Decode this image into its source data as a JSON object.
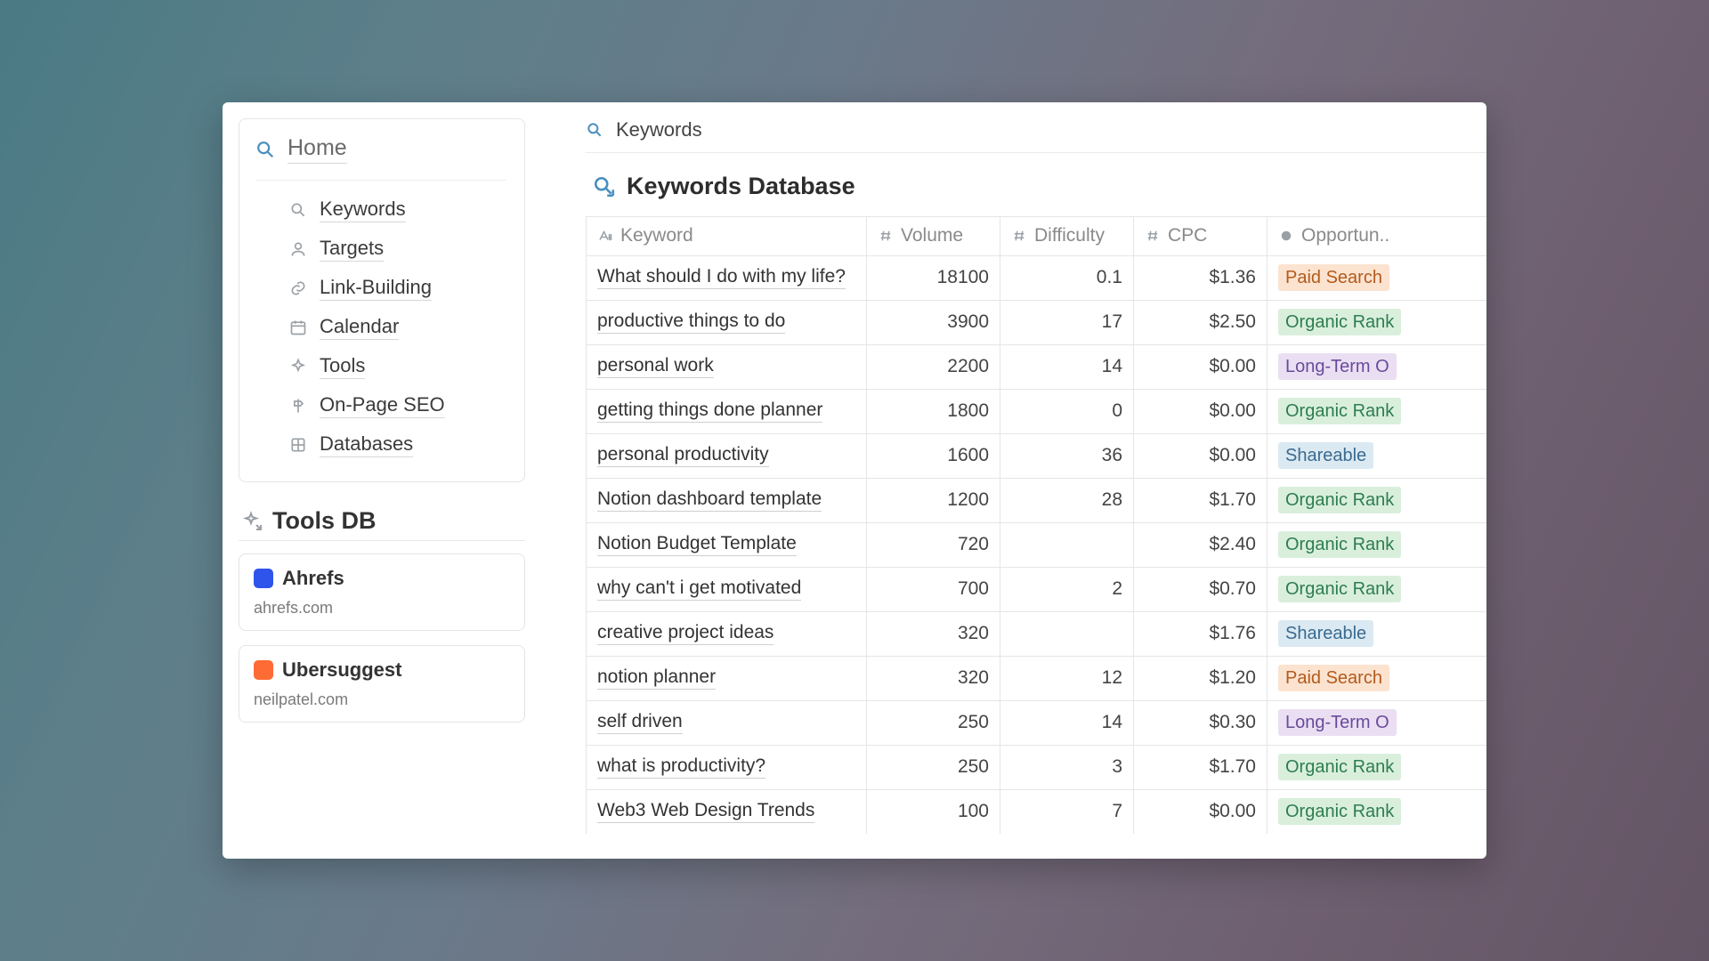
{
  "sidebar": {
    "home_label": "Home",
    "items": [
      {
        "label": "Keywords"
      },
      {
        "label": "Targets"
      },
      {
        "label": "Link-Building"
      },
      {
        "label": "Calendar"
      },
      {
        "label": "Tools"
      },
      {
        "label": "On-Page SEO"
      },
      {
        "label": "Databases"
      }
    ]
  },
  "tools_db": {
    "title": "Tools DB",
    "cards": [
      {
        "name": "Ahrefs",
        "domain": "ahrefs.com",
        "icon_color": "#2f54eb"
      },
      {
        "name": "Ubersuggest",
        "domain": "neilpatel.com",
        "icon_color": "#ff6b35"
      }
    ]
  },
  "main": {
    "breadcrumb_label": "Keywords",
    "db_title": "Keywords Database",
    "columns": {
      "keyword": "Keyword",
      "volume": "Volume",
      "difficulty": "Difficulty",
      "cpc": "CPC",
      "opportunity": "Opportun.."
    },
    "rows": [
      {
        "keyword": "What should I do with my life?",
        "volume": "18100",
        "difficulty": "0.1",
        "cpc": "$1.36",
        "opportunity": "Paid Search",
        "tag": "paid"
      },
      {
        "keyword": "productive things to do",
        "volume": "3900",
        "difficulty": "17",
        "cpc": "$2.50",
        "opportunity": "Organic Rank",
        "tag": "organic"
      },
      {
        "keyword": "personal work",
        "volume": "2200",
        "difficulty": "14",
        "cpc": "$0.00",
        "opportunity": "Long-Term O",
        "tag": "longterm"
      },
      {
        "keyword": "getting things done planner",
        "volume": "1800",
        "difficulty": "0",
        "cpc": "$0.00",
        "opportunity": "Organic Rank",
        "tag": "organic"
      },
      {
        "keyword": "personal productivity",
        "volume": "1600",
        "difficulty": "36",
        "cpc": "$0.00",
        "opportunity": "Shareable",
        "tag": "share"
      },
      {
        "keyword": "Notion dashboard template",
        "volume": "1200",
        "difficulty": "28",
        "cpc": "$1.70",
        "opportunity": "Organic Rank",
        "tag": "organic"
      },
      {
        "keyword": "Notion Budget Template",
        "volume": "720",
        "difficulty": "",
        "cpc": "$2.40",
        "opportunity": "Organic Rank",
        "tag": "organic"
      },
      {
        "keyword": "why can't i get motivated",
        "volume": "700",
        "difficulty": "2",
        "cpc": "$0.70",
        "opportunity": "Organic Rank",
        "tag": "organic"
      },
      {
        "keyword": "creative project ideas",
        "volume": "320",
        "difficulty": "",
        "cpc": "$1.76",
        "opportunity": "Shareable",
        "tag": "share"
      },
      {
        "keyword": "notion planner",
        "volume": "320",
        "difficulty": "12",
        "cpc": "$1.20",
        "opportunity": "Paid Search",
        "tag": "paid"
      },
      {
        "keyword": "self driven",
        "volume": "250",
        "difficulty": "14",
        "cpc": "$0.30",
        "opportunity": "Long-Term O",
        "tag": "longterm"
      },
      {
        "keyword": "what is productivity?",
        "volume": "250",
        "difficulty": "3",
        "cpc": "$1.70",
        "opportunity": "Organic Rank",
        "tag": "organic"
      },
      {
        "keyword": "Web3 Web Design Trends",
        "volume": "100",
        "difficulty": "7",
        "cpc": "$0.00",
        "opportunity": "Organic Rank",
        "tag": "organic"
      }
    ]
  }
}
